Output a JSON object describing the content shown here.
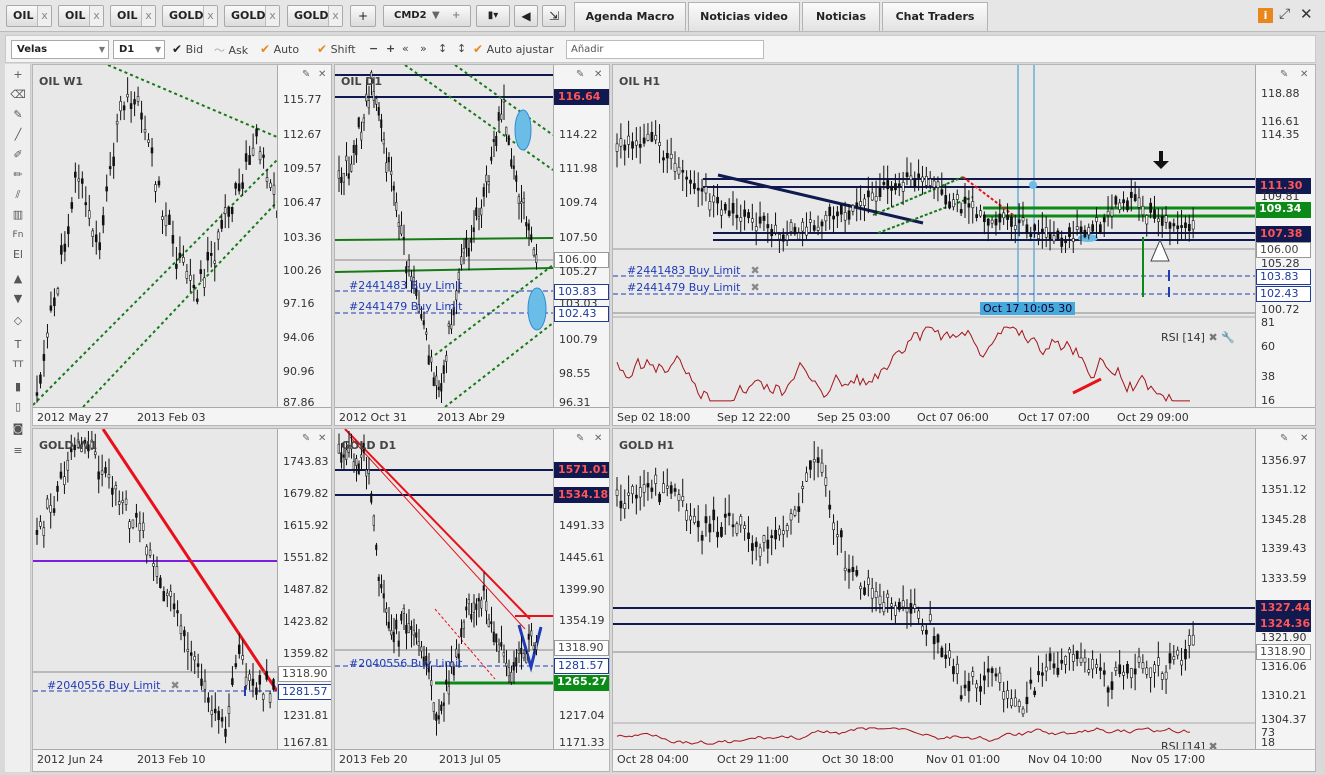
{
  "tabs": {
    "instrument_tabs": [
      "OIL",
      "OIL",
      "OIL",
      "GOLD",
      "GOLD",
      "GOLD"
    ],
    "add_label": "+",
    "command_select": "CMD2",
    "nav_tabs": [
      "Agenda Macro",
      "Noticias video",
      "Noticias",
      "Chat Traders"
    ]
  },
  "toolbar": {
    "chart_type": "Velas",
    "timeframe": "D1",
    "bid": "Bid",
    "ask": "Ask",
    "auto": "Auto",
    "shift": "Shift",
    "auto_adjust": "Auto ajustar",
    "add_placeholder": "Añadir"
  },
  "panels": {
    "oil_w1": {
      "title": "OIL W1",
      "yticks": [
        "115.77",
        "112.67",
        "109.57",
        "106.47",
        "103.36",
        "100.26",
        "97.16",
        "94.06",
        "90.96",
        "87.86"
      ],
      "xticks": [
        "2012 May 27",
        "2013 Feb 03"
      ]
    },
    "oil_d1": {
      "title": "OIL D1",
      "yticks": [
        "114.22",
        "111.98",
        "109.74",
        "107.50",
        "105.27",
        "103.03",
        "100.79",
        "98.55",
        "96.31"
      ],
      "xticks": [
        "2012 Oct 31",
        "2013 Abr 29"
      ],
      "tags": [
        "116.64",
        "106.00",
        "103.83",
        "102.43"
      ],
      "orders": [
        "#2441483 Buy Limit",
        "#2441479 Buy Limit"
      ]
    },
    "oil_h1": {
      "title": "OIL H1",
      "yticks": [
        "118.88",
        "116.61",
        "114.35",
        "109.81",
        "105.28",
        "100.72"
      ],
      "xticks": [
        "Sep 02 18:00",
        "Sep 12 22:00",
        "Sep 25 03:00",
        "Oct 07 06:00",
        "Oct 17 07:00",
        "Oct 29 09:00"
      ],
      "tags": [
        "111.30",
        "109.34",
        "107.38",
        "106.00",
        "103.83",
        "102.43"
      ],
      "orders": [
        "#2441483 Buy Limit",
        "#2441479 Buy Limit"
      ],
      "cursor_label": "Oct 17 10:05 30",
      "rsi_label": "RSI [14]",
      "rsi_ticks": [
        "81",
        "60",
        "38",
        "16"
      ]
    },
    "gold_w1": {
      "title": "GOLD W1",
      "yticks": [
        "1743.83",
        "1679.82",
        "1615.92",
        "1551.82",
        "1487.82",
        "1423.82",
        "1359.82",
        "1231.81",
        "1167.81"
      ],
      "xticks": [
        "2012 Jun 24",
        "2013 Feb 10"
      ],
      "tags": [
        "1318.90",
        "1281.57"
      ],
      "orders": [
        "#2040556 Buy Limit"
      ]
    },
    "gold_d1": {
      "title": "GOLD D1",
      "yticks": [
        "1491.33",
        "1445.61",
        "1399.90",
        "1354.19",
        "1217.04",
        "1171.33"
      ],
      "xticks": [
        "2013 Feb 20",
        "2013 Jul 05"
      ],
      "tags": [
        "1571.01",
        "1534.18",
        "1318.90",
        "1281.57",
        "1265.27"
      ],
      "orders": [
        "#2040556 Buy Limit"
      ]
    },
    "gold_h1": {
      "title": "GOLD H1",
      "yticks": [
        "1356.97",
        "1351.12",
        "1345.28",
        "1339.43",
        "1333.59",
        "1321.90",
        "1316.06",
        "1310.21",
        "1304.37"
      ],
      "xticks": [
        "Oct 28 04:00",
        "Oct 29 11:00",
        "Oct 30 18:00",
        "Nov 01 01:00",
        "Nov 04 10:00",
        "Nov 05 17:00"
      ],
      "tags": [
        "1327.44",
        "1324.36",
        "1318.90"
      ],
      "rsi_label": "RSI [14]",
      "rsi_ticks": [
        "73",
        "18"
      ]
    }
  },
  "colors": {
    "navy_level": "#101a50",
    "green_level": "#0c8a17",
    "trend_red": "#e8111a",
    "trend_green": "#177a17",
    "order_blue": "#1f3bb5",
    "rsi": "#a3131a"
  }
}
